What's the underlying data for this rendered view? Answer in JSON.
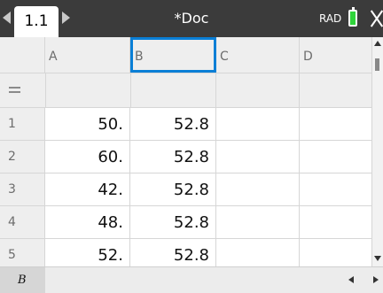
{
  "tab": {
    "label": "1.1"
  },
  "document": {
    "title": "*Doc"
  },
  "status": {
    "angle_mode": "RAD",
    "battery_color": "#2fd43a"
  },
  "columns": [
    {
      "letter": "A"
    },
    {
      "letter": "B"
    },
    {
      "letter": "C"
    },
    {
      "letter": "D"
    }
  ],
  "selected_column": "B",
  "rows": [
    {
      "num": "1",
      "a": "50.",
      "b": "52.8",
      "c": "",
      "d": ""
    },
    {
      "num": "2",
      "a": "60.",
      "b": "52.8",
      "c": "",
      "d": ""
    },
    {
      "num": "3",
      "a": "42.",
      "b": "52.8",
      "c": "",
      "d": ""
    },
    {
      "num": "4",
      "a": "48.",
      "b": "52.8",
      "c": "",
      "d": ""
    },
    {
      "num": "5",
      "a": "52.",
      "b": "52.8",
      "c": "",
      "d": ""
    }
  ],
  "entry": {
    "cell_ref": "B",
    "value": ""
  },
  "colors": {
    "selection": "#0a7fd6",
    "topbar": "#3b3b3b"
  }
}
